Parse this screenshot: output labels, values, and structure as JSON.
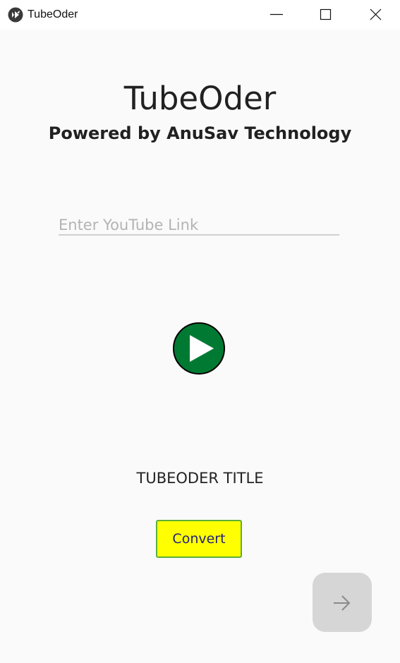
{
  "window": {
    "title": "TubeOder",
    "icon": "kivy-app-icon",
    "controls": [
      "minimize-icon",
      "maximize-icon",
      "close-icon"
    ]
  },
  "header": {
    "title": "TubeOder",
    "subtitle": "Powered by AnuSav Technology"
  },
  "url_input": {
    "placeholder": "Enter YouTube Link",
    "value": ""
  },
  "play_button": {
    "icon": "play-icon",
    "color": "#007a33"
  },
  "video": {
    "title": "TUBEODER TITLE"
  },
  "convert_button": {
    "label": "Convert",
    "background": "#ffff00"
  },
  "next_button": {
    "icon": "arrow-right-icon",
    "background": "#d6d6d6"
  }
}
